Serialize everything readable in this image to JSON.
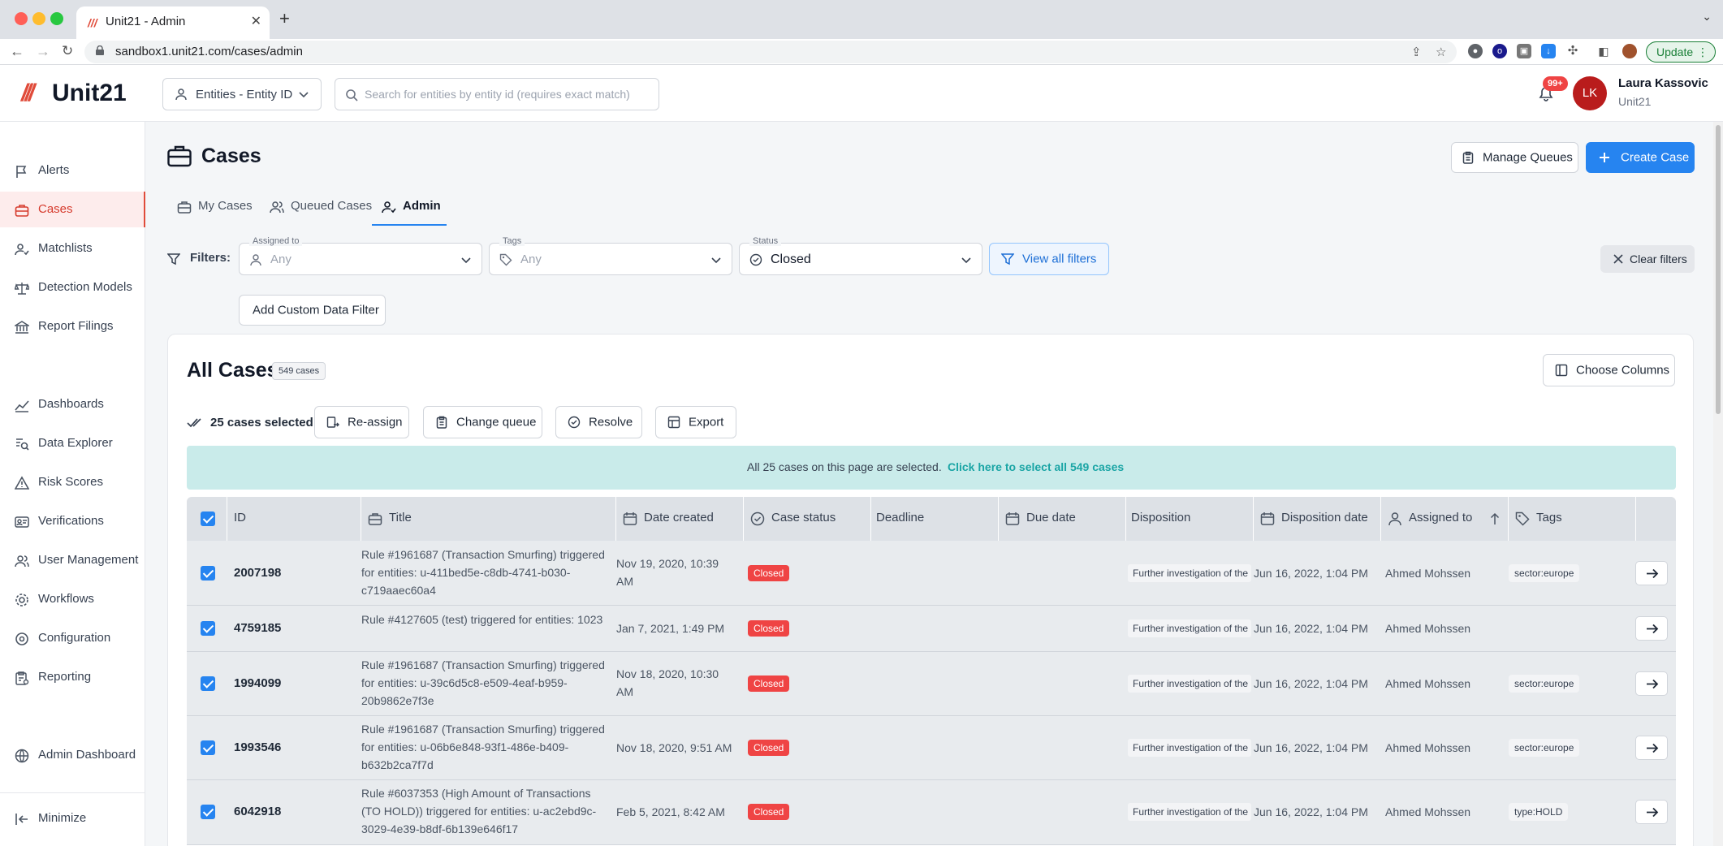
{
  "browser": {
    "tab_title": "Unit21 - Admin",
    "url": "sandbox1.unit21.com/cases/admin",
    "update_label": "Update"
  },
  "header": {
    "logo_text": "Unit21",
    "entity_select": "Entities - Entity ID",
    "search_placeholder": "Search for entities by entity id (requires exact match)",
    "notification_count": "99+",
    "avatar_initials": "LK",
    "user_name": "Laura Kassovic",
    "user_org": "Unit21"
  },
  "sidebar": {
    "items": [
      {
        "label": "Alerts"
      },
      {
        "label": "Cases"
      },
      {
        "label": "Matchlists"
      },
      {
        "label": "Detection Models"
      },
      {
        "label": "Report Filings"
      },
      {
        "label": "Dashboards"
      },
      {
        "label": "Data Explorer"
      },
      {
        "label": "Risk Scores"
      },
      {
        "label": "Verifications"
      },
      {
        "label": "User Management"
      },
      {
        "label": "Workflows"
      },
      {
        "label": "Configuration"
      },
      {
        "label": "Reporting"
      },
      {
        "label": "Admin Dashboard"
      }
    ],
    "minimize_label": "Minimize"
  },
  "page": {
    "title": "Cases",
    "manage_queues_label": "Manage Queues",
    "create_case_label": "Create Case",
    "tabs": [
      {
        "label": "My Cases"
      },
      {
        "label": "Queued Cases"
      },
      {
        "label": "Admin"
      }
    ]
  },
  "filters": {
    "label": "Filters:",
    "assigned_caption": "Assigned to",
    "assigned_value": "Any",
    "tags_caption": "Tags",
    "tags_value": "Any",
    "status_caption": "Status",
    "status_value": "Closed",
    "view_all_label": "View all filters",
    "clear_label": "Clear filters",
    "custom_filter_label": "Add Custom Data Filter"
  },
  "card": {
    "title": "All Cases",
    "count_badge": "549 cases",
    "choose_columns_label": "Choose Columns",
    "selected_text": "25 cases selected:",
    "actions": {
      "reassign": "Re-assign",
      "change_queue": "Change queue",
      "resolve": "Resolve",
      "export": "Export"
    },
    "banner_text": "All 25 cases on this page are selected.",
    "banner_link": "Click here to select all 549 cases"
  },
  "table": {
    "columns": {
      "id": "ID",
      "title": "Title",
      "date_created": "Date created",
      "case_status": "Case status",
      "deadline": "Deadline",
      "due_date": "Due date",
      "disposition": "Disposition",
      "disposition_date": "Disposition date",
      "assigned_to": "Assigned to",
      "tags": "Tags"
    },
    "rows": [
      {
        "id": "2007198",
        "title": "Rule #1961687 (Transaction Smurfing) triggered for entities: u-411bed5e-c8db-4741-b030-c719aaec60a4",
        "date_created": "Nov 19, 2020, 10:39 AM",
        "status": "Closed",
        "disposition": "Further investigation of the",
        "disposition_date": "Jun 16, 2022, 1:04 PM",
        "assigned_to": "Ahmed Mohssen",
        "tag": "sector:europe"
      },
      {
        "id": "4759185",
        "title": "Rule #4127605 (test) triggered for entities: 1023",
        "date_created": "Jan 7, 2021, 1:49 PM",
        "status": "Closed",
        "disposition": "Further investigation of the",
        "disposition_date": "Jun 16, 2022, 1:04 PM",
        "assigned_to": "Ahmed Mohssen",
        "tag": ""
      },
      {
        "id": "1994099",
        "title": "Rule #1961687 (Transaction Smurfing) triggered for entities: u-39c6d5c8-e509-4eaf-b959-20b9862e7f3e",
        "date_created": "Nov 18, 2020, 10:30 AM",
        "status": "Closed",
        "disposition": "Further investigation of the",
        "disposition_date": "Jun 16, 2022, 1:04 PM",
        "assigned_to": "Ahmed Mohssen",
        "tag": "sector:europe"
      },
      {
        "id": "1993546",
        "title": "Rule #1961687 (Transaction Smurfing) triggered for entities: u-06b6e848-93f1-486e-b409-b632b2ca7f7d",
        "date_created": "Nov 18, 2020, 9:51 AM",
        "status": "Closed",
        "disposition": "Further investigation of the",
        "disposition_date": "Jun 16, 2022, 1:04 PM",
        "assigned_to": "Ahmed Mohssen",
        "tag": "sector:europe"
      },
      {
        "id": "6042918",
        "title": "Rule #6037353 (High Amount of Transactions (TO HOLD)) triggered for entities: u-ac2ebd9c-3029-4e39-b8df-6b139e646f17",
        "date_created": "Feb 5, 2021, 8:42 AM",
        "status": "Closed",
        "disposition": "Further investigation of the",
        "disposition_date": "Jun 16, 2022, 1:04 PM",
        "assigned_to": "Ahmed Mohssen",
        "tag": "type:HOLD"
      }
    ]
  }
}
